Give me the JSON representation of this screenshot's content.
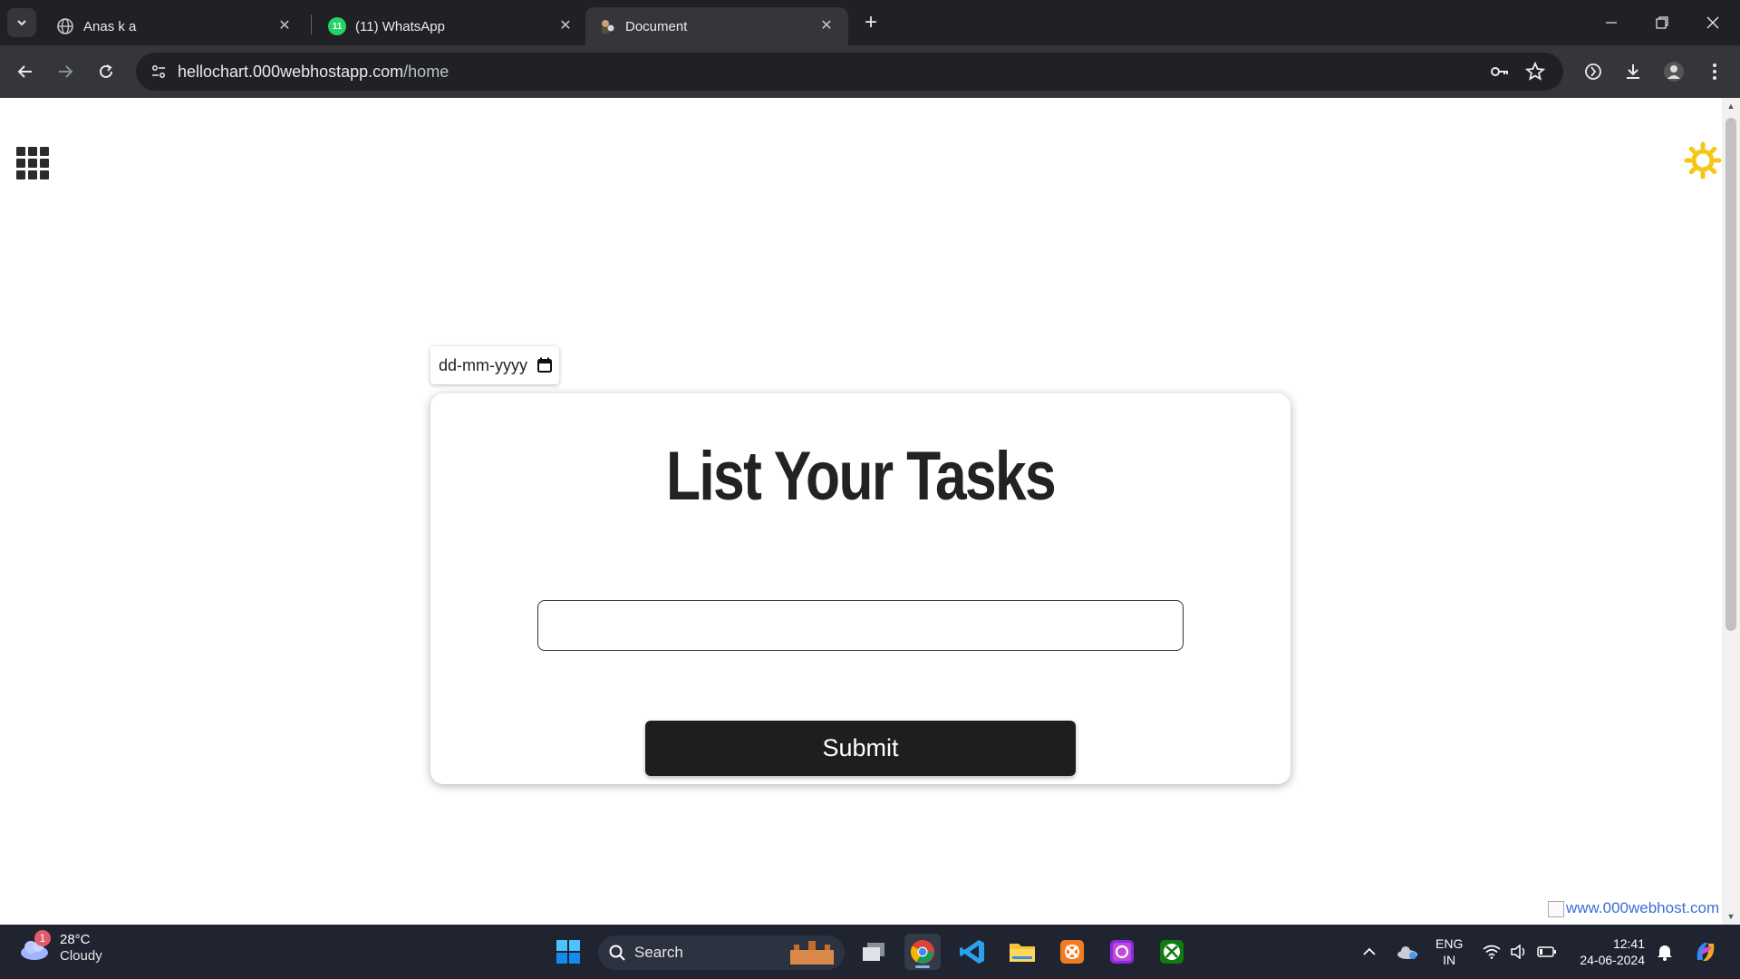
{
  "browser": {
    "tabs": [
      {
        "title": "Anas k a",
        "icon": "globe-icon"
      },
      {
        "title": "(11) WhatsApp",
        "icon": "whatsapp-icon",
        "badge": "11"
      },
      {
        "title": "Document",
        "icon": "document-favicon",
        "active": true
      }
    ],
    "url_host": "hellochart.000webhostapp.com",
    "url_path": "/home"
  },
  "page": {
    "date_placeholder": "dd-mm-yyyy",
    "title": "List Your Tasks",
    "task_input_value": "",
    "submit_label": "Submit",
    "host_badge": "www.000webhost.com",
    "accent_sun": "#f5c518"
  },
  "taskbar": {
    "weather": {
      "temp": "28°C",
      "condition": "Cloudy",
      "badge": "1"
    },
    "search_label": "Search",
    "lang": {
      "line1": "ENG",
      "line2": "IN"
    },
    "clock": {
      "time": "12:41",
      "date": "24-06-2024"
    }
  }
}
